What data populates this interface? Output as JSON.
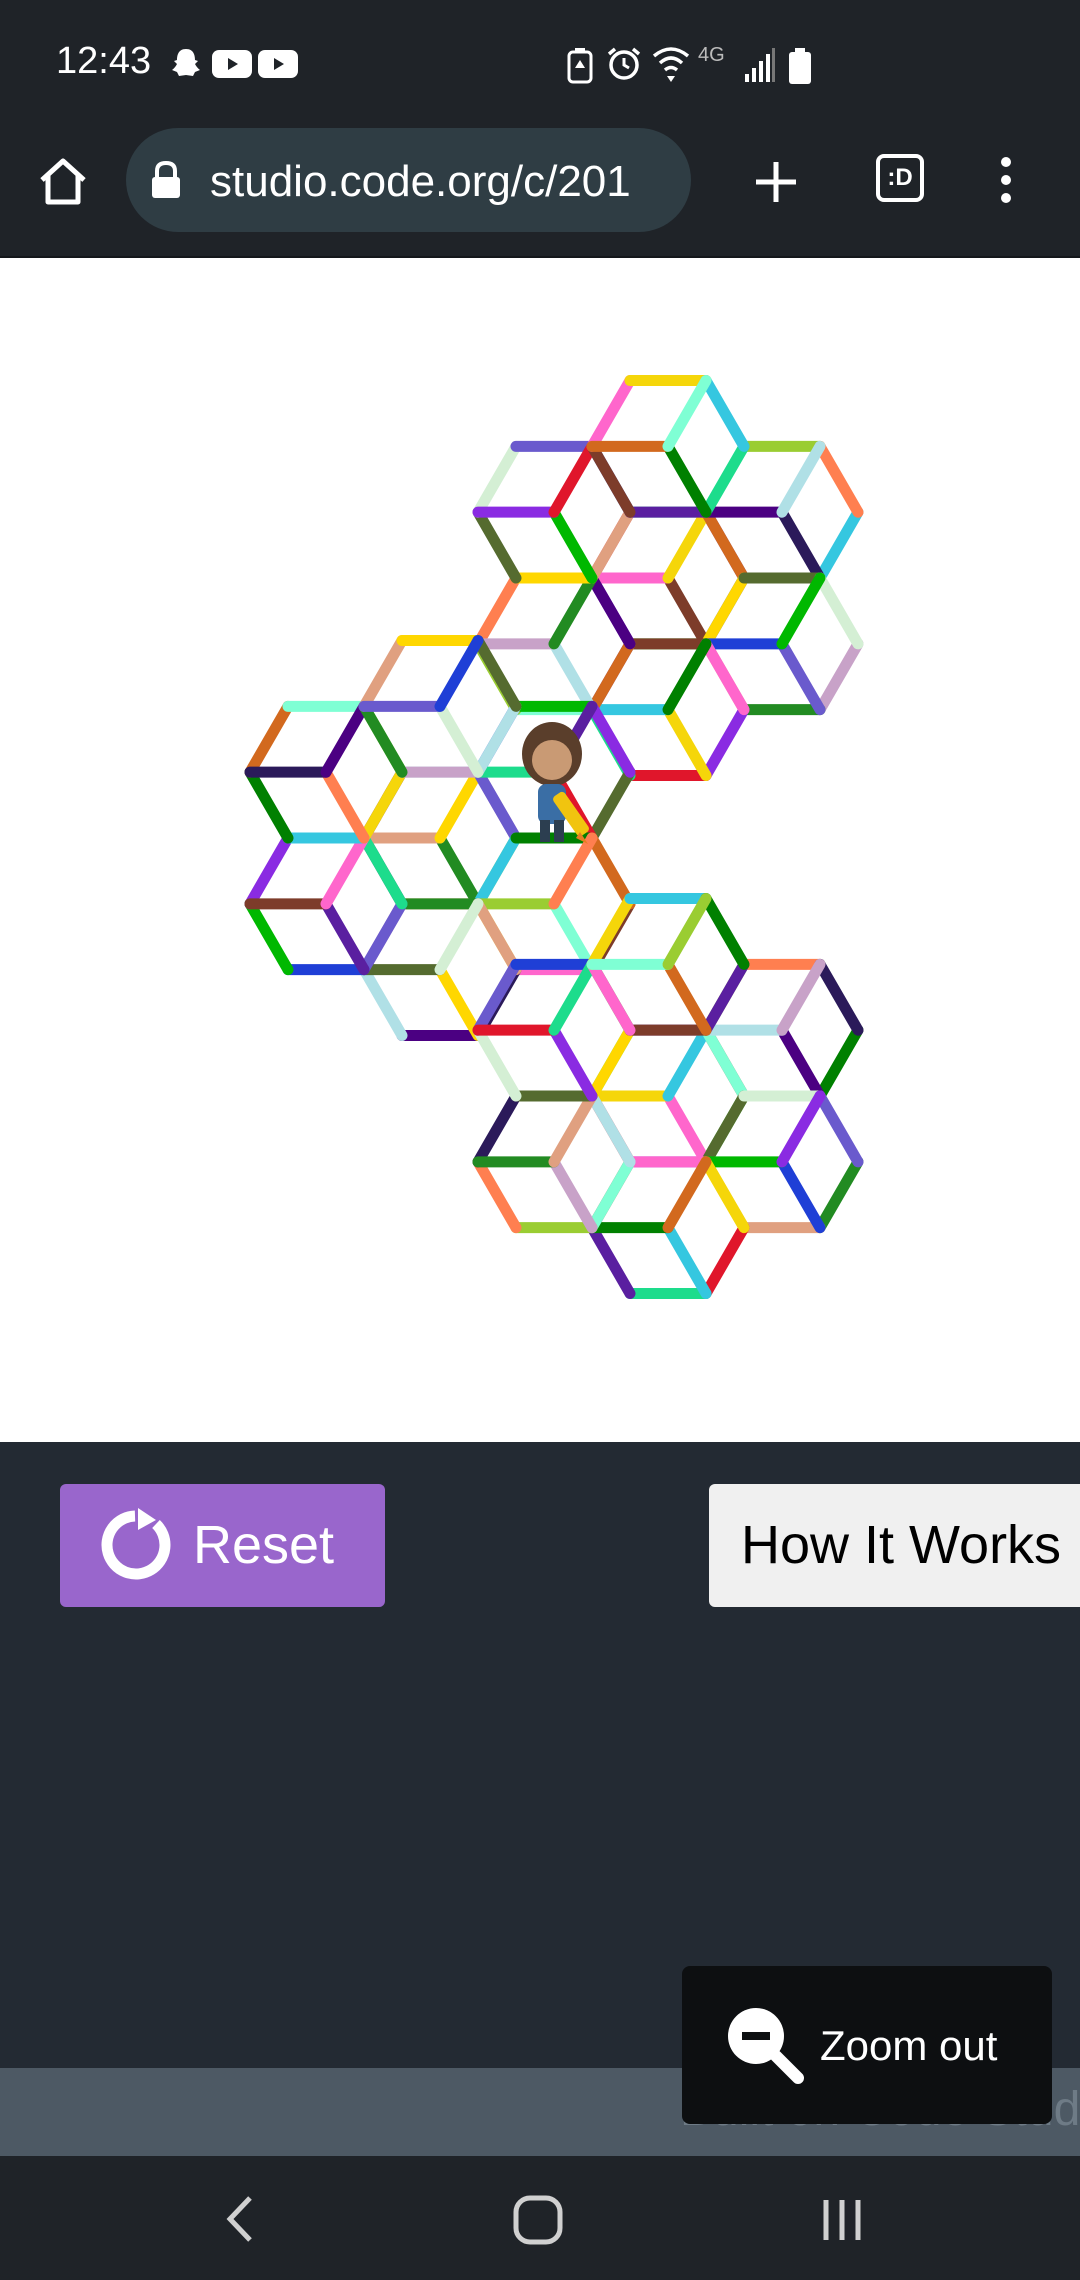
{
  "status_bar": {
    "time": "12:43",
    "left_icons": [
      "snapchat-icon",
      "youtube-icon",
      "youtube-icon"
    ],
    "right_icons": [
      "battery-saver-icon",
      "alarm-icon",
      "wifi-icon",
      "lte-icon",
      "signal-icon",
      "battery-icon"
    ],
    "network_label": "4G"
  },
  "browser": {
    "url": "studio.code.org/c/201",
    "tab_count": ":D",
    "icons": [
      "home-icon",
      "lock-icon",
      "new-tab-icon",
      "tab-switcher-icon",
      "more-vert-icon"
    ]
  },
  "controls": {
    "reset_label": "Reset",
    "how_label": "How It Works",
    "zoom_label": "Zoom out"
  },
  "footer": {
    "built_on": "Built on Code Studio"
  },
  "colors": {
    "reset_bg": "#9966cc",
    "dark_bg": "#232a33",
    "status_bg": "#1f2328"
  }
}
